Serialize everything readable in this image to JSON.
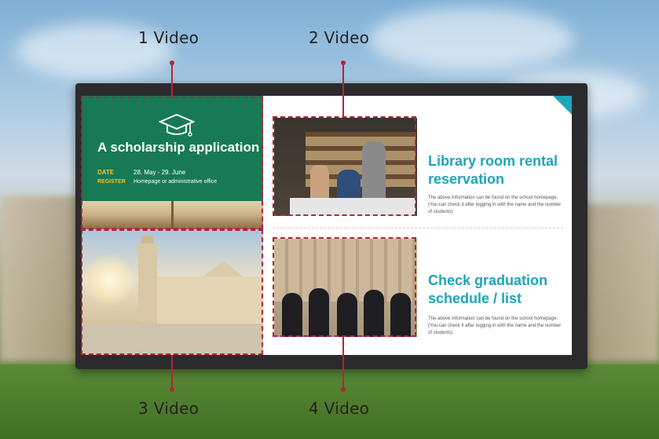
{
  "callouts": {
    "video1": "1 Video",
    "video2": "2 Video",
    "video3": "3 Video",
    "video4": "4 Video"
  },
  "scholarship": {
    "icon": "graduation-cap-icon",
    "title": "A scholarship application",
    "date_label": "DATE",
    "date_value": "28. May - 29. June",
    "register_label": "REGISTER",
    "register_value": "Homepage or administrative office"
  },
  "library": {
    "heading": "Library room rental reservation",
    "note": "The above information can be found on the school homepage. (You can check it after logging in with the name and the number of students)"
  },
  "graduation": {
    "heading": "Check graduation schedule / list",
    "note": "The above information can be found on the school homepage. (You can check it after logging in with the name and the number of students)"
  },
  "colors": {
    "accent": "#1ea5b9",
    "scholar_bg": "#177a55",
    "highlight": "#f2c230",
    "marker": "#b3243a"
  }
}
